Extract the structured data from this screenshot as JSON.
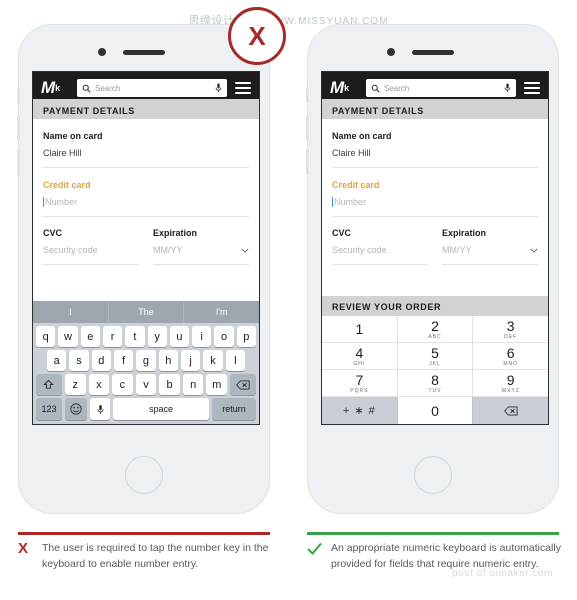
{
  "watermark": {
    "cn": "思缘设计论坛",
    "url": "WWW.MISSYUAN.COM",
    "lower": "post of uimaker.com"
  },
  "badges": {
    "bad": "X",
    "bad_color": "#a52a2a",
    "good_icon": "check-icon",
    "good_color": "#3aa14b"
  },
  "app": {
    "logo": "M",
    "logo_mark": "k",
    "search_placeholder": "Search",
    "search_icon": "search-icon",
    "mic_icon": "microphone-icon",
    "menu_icon": "hamburger-menu-icon"
  },
  "form": {
    "section_title": "PAYMENT DETAILS",
    "name_label": "Name on card",
    "name_value": "Claire Hill",
    "card_label": "Credit card",
    "card_placeholder": "Number",
    "cvc_label": "CVC",
    "cvc_placeholder": "Security code",
    "exp_label": "Expiration",
    "exp_placeholder": "MM/YY",
    "accent_color": "#e6a33c",
    "caret_color": "#4a90d9",
    "review_title": "REVIEW YOUR ORDER"
  },
  "qwerty": {
    "suggestions": [
      "I",
      "The",
      "I'm"
    ],
    "row1": [
      "q",
      "w",
      "e",
      "r",
      "t",
      "y",
      "u",
      "i",
      "o",
      "p"
    ],
    "row2": [
      "a",
      "s",
      "d",
      "f",
      "g",
      "h",
      "j",
      "k",
      "l"
    ],
    "row3": [
      "z",
      "x",
      "c",
      "v",
      "b",
      "n",
      "m"
    ],
    "shift_icon": "shift-icon",
    "backspace_icon": "backspace-icon",
    "numbers_key": "123",
    "emoji_icon": "emoji-icon",
    "mic_icon": "microphone-icon",
    "space_key": "space",
    "return_key": "return"
  },
  "numpad": {
    "keys": [
      {
        "digit": "1",
        "letters": ""
      },
      {
        "digit": "2",
        "letters": "ABC"
      },
      {
        "digit": "3",
        "letters": "DEF"
      },
      {
        "digit": "4",
        "letters": "GHI"
      },
      {
        "digit": "5",
        "letters": "JKL"
      },
      {
        "digit": "6",
        "letters": "MNO"
      },
      {
        "digit": "7",
        "letters": "PQRS"
      },
      {
        "digit": "8",
        "letters": "TUV"
      },
      {
        "digit": "9",
        "letters": "WXYZ"
      }
    ],
    "symbols_key": "+ ∗ #",
    "zero_key": "0",
    "backspace_icon": "backspace-icon"
  },
  "captions": {
    "bad_mark": "X",
    "bad_text": "The user is required to tap the number key in the keyboard to enable number entry.",
    "good_mark": "check-icon",
    "good_text": "An appropriate numeric keyboard is automatically provided for fields that require numeric entry."
  }
}
